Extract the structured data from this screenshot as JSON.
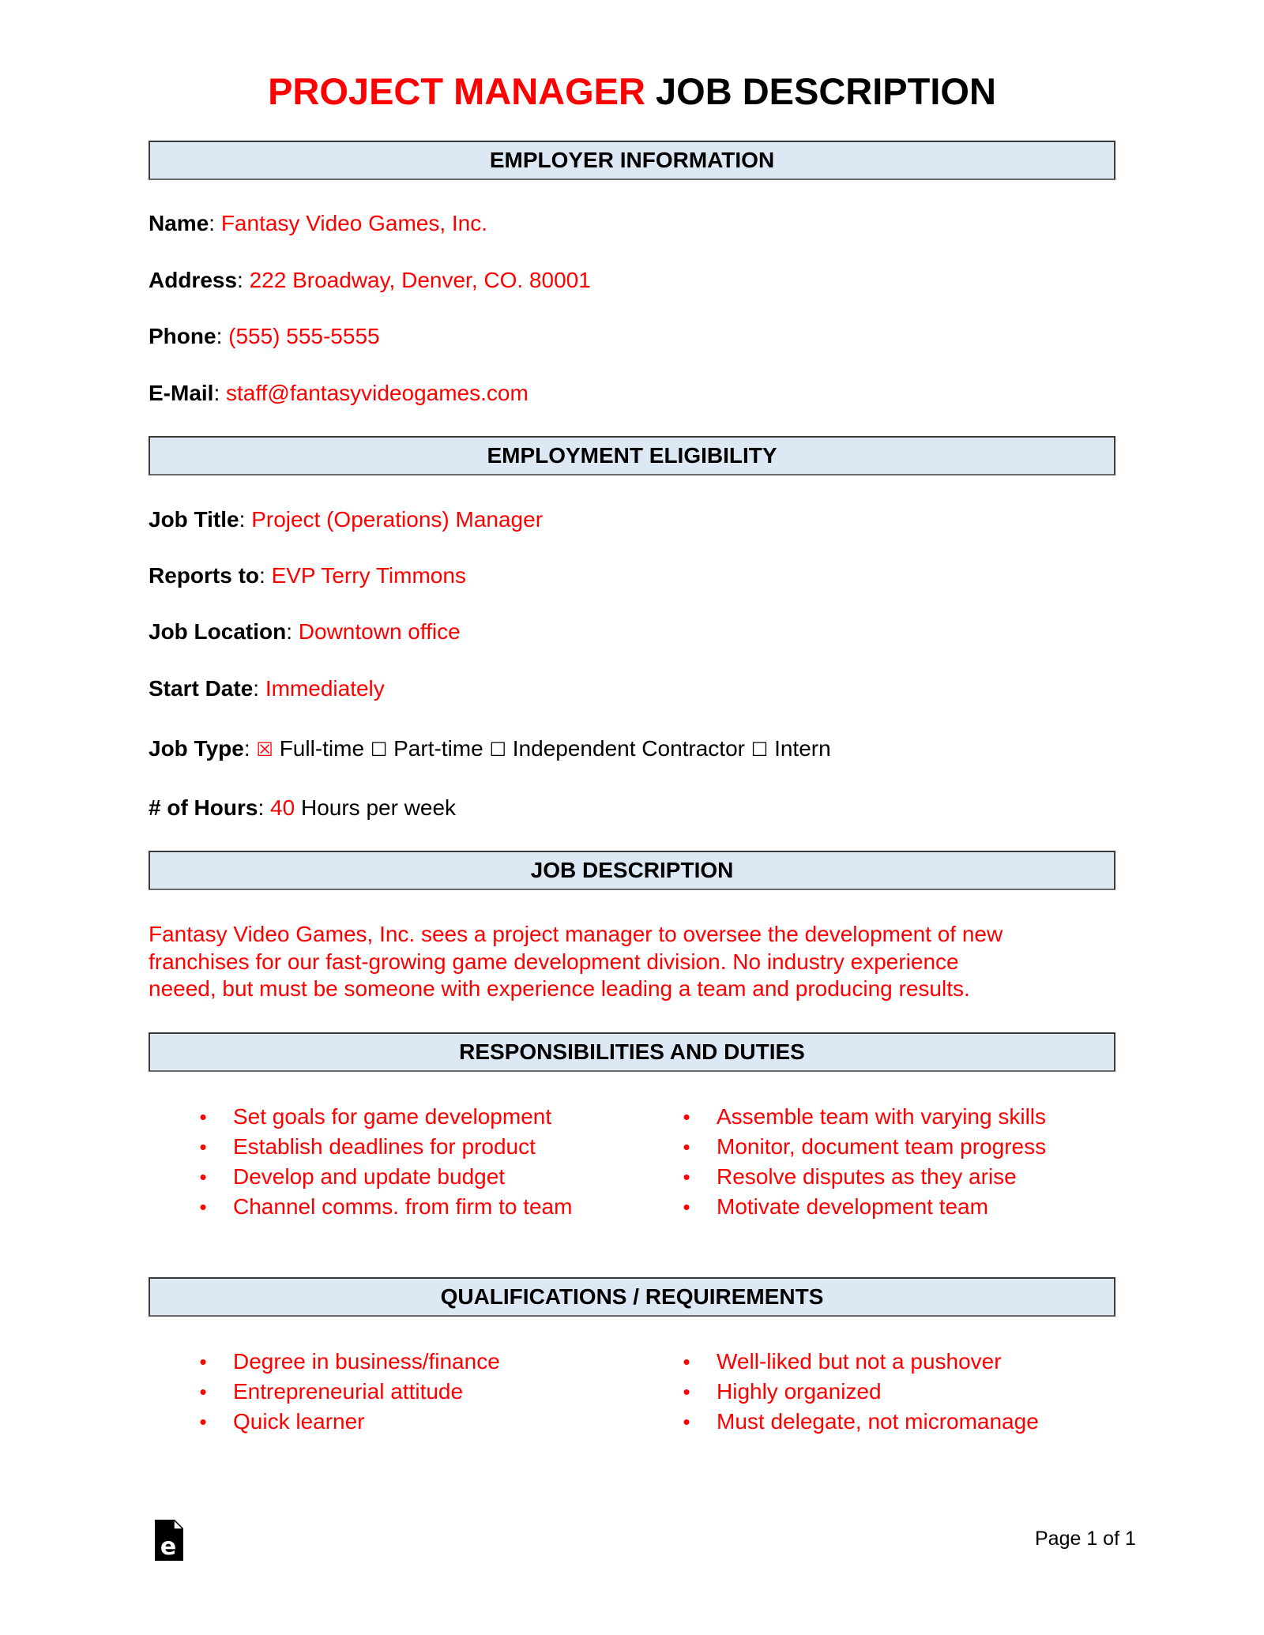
{
  "title": {
    "highlight": "PROJECT MANAGER",
    "rest": "JOB DESCRIPTION"
  },
  "colors": {
    "accent": "#ff0000",
    "header_fill": "#dde8f5",
    "header_border": "#3a3a3a",
    "text": "#000000"
  },
  "sections": {
    "employer": {
      "heading": "EMPLOYER INFORMATION",
      "fields": [
        {
          "label": "Name",
          "value": "Fantasy Video Games, Inc."
        },
        {
          "label": "Address",
          "value": "222 Broadway, Denver, CO. 80001"
        },
        {
          "label": "Phone",
          "value": "(555) 555-5555"
        },
        {
          "label": "E-Mail",
          "value": "staff@fantasyvideogames.com"
        }
      ]
    },
    "eligibility": {
      "heading": "EMPLOYMENT ELIGIBILITY",
      "fields": [
        {
          "label": "Job Title",
          "value": "Project (Operations) Manager"
        },
        {
          "label": "Reports to",
          "value": "EVP Terry Timmons"
        },
        {
          "label": "Job Location",
          "value": "Downtown office"
        },
        {
          "label": "Start Date",
          "value": "Immediately"
        }
      ],
      "job_type": {
        "label": "Job Type",
        "options": [
          {
            "label": "Full-time",
            "checked": true,
            "glyph": "☒"
          },
          {
            "label": "Part-time",
            "checked": false,
            "glyph": "☐"
          },
          {
            "label": "Independent Contractor",
            "checked": false,
            "glyph": "☐"
          },
          {
            "label": "Intern",
            "checked": false,
            "glyph": "☐"
          }
        ]
      },
      "hours": {
        "label": "# of Hours",
        "value": "40",
        "suffix": "Hours per week"
      }
    },
    "description": {
      "heading": "JOB DESCRIPTION",
      "lines": [
        "Fantasy Video Games, Inc. sees a project manager to oversee the development of new",
        "franchises for our fast-growing game development division. No industry experience",
        "neeed, but must be someone with experience leading a team and producing results."
      ]
    },
    "responsibilities": {
      "heading": "RESPONSIBILITIES AND DUTIES",
      "left": [
        "Set goals for game development",
        "Establish deadlines for product",
        "Develop and update budget",
        "Channel comms. from firm to team"
      ],
      "right": [
        "Assemble team with varying skills",
        "Monitor, document team progress",
        "Resolve disputes as they arise",
        "Motivate development team"
      ]
    },
    "qualifications": {
      "heading": "QUALIFICATIONS / REQUIREMENTS",
      "left": [
        "Degree in business/finance",
        "Entrepreneurial attitude",
        "Quick learner"
      ],
      "right": [
        "Well-liked but not a pushover",
        "Highly organized",
        "Must delegate, not micromanage"
      ]
    }
  },
  "footer": {
    "logo_icon": "eforms-document-icon",
    "page_label": "Page 1 of 1"
  }
}
